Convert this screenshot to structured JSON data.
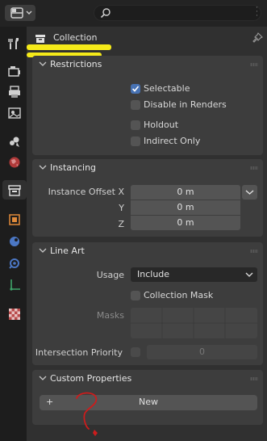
{
  "header": {
    "title": "Collection"
  },
  "panels": {
    "restrictions": {
      "title": "Restrictions",
      "selectable": "Selectable",
      "disable_renders": "Disable in Renders",
      "holdout": "Holdout",
      "indirect_only": "Indirect Only"
    },
    "instancing": {
      "title": "Instancing",
      "offset_label": "Instance Offset X",
      "y_label": "Y",
      "z_label": "Z",
      "x_value": "0 m",
      "y_value": "0 m",
      "z_value": "0 m"
    },
    "line_art": {
      "title": "Line Art",
      "usage_label": "Usage",
      "usage_value": "Include",
      "collection_mask": "Collection Mask",
      "masks_label": "Masks",
      "intersection_label": "Intersection Priority",
      "intersection_value": "0"
    },
    "custom_properties": {
      "title": "Custom Properties",
      "new_button": "New",
      "plus": "+"
    }
  },
  "colors": {
    "accent": "#4772b3",
    "highlight": "#f5ea19",
    "annotation": "#cc1c1c"
  }
}
